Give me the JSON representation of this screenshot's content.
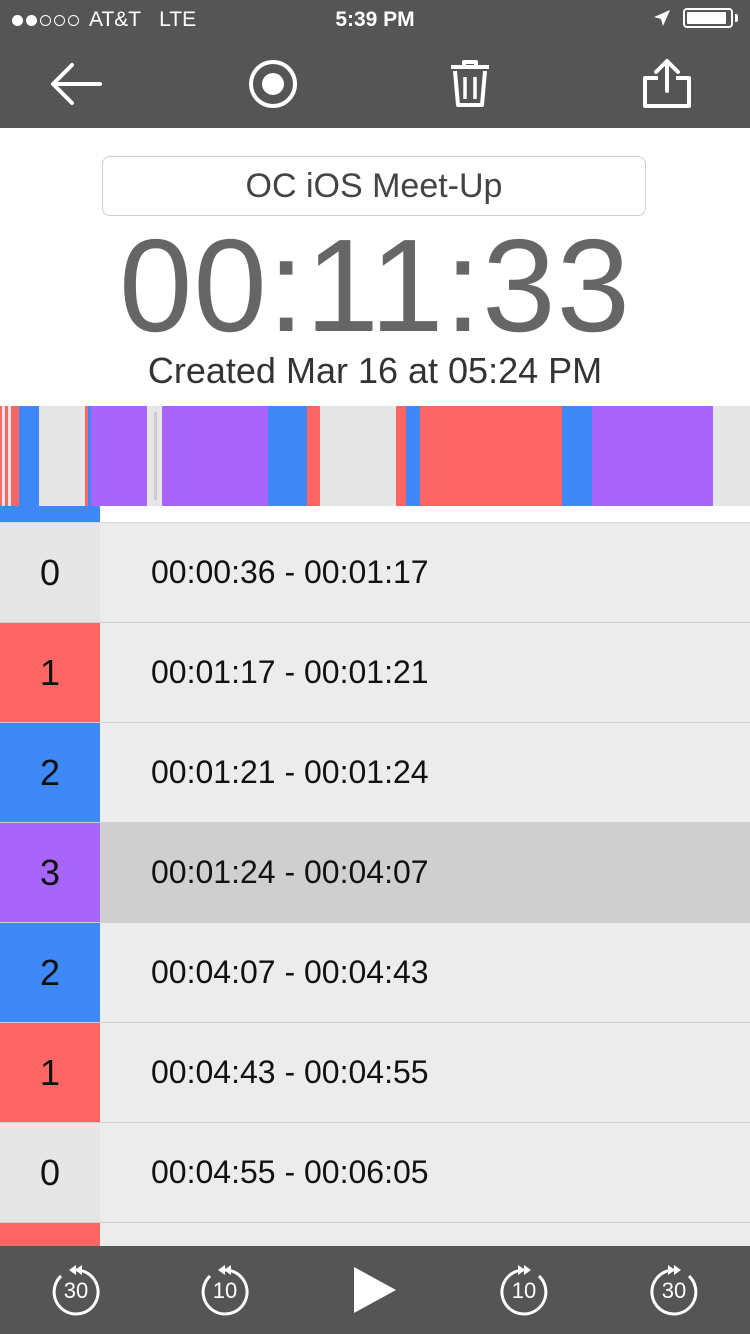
{
  "status": {
    "carrier": "AT&T",
    "network": "LTE",
    "time": "5:39 PM",
    "signal_dots": [
      true,
      true,
      false,
      false,
      false
    ],
    "battery_level": 0.92
  },
  "toolbar": {
    "icons": [
      "back-arrow-icon",
      "record-icon",
      "trash-icon",
      "share-icon"
    ]
  },
  "recording": {
    "title": "OC iOS Meet-Up",
    "elapsed": "00:11:33",
    "created": "Created Mar 16 at 05:24 PM"
  },
  "colors": {
    "level_0": "#e6e6e6",
    "level_1": "#fe6665",
    "level_2": "#3f88f7",
    "level_3": "#a765fb",
    "bar": "#555555"
  },
  "timeline": {
    "segments": [
      {
        "level": 1,
        "start": 0,
        "end": 0.003
      },
      {
        "level": 0,
        "start": 0.003,
        "end": 0.007
      },
      {
        "level": 1,
        "start": 0.007,
        "end": 0.011
      },
      {
        "level": 0,
        "start": 0.011,
        "end": 0.015
      },
      {
        "level": 1,
        "start": 0.015,
        "end": 0.025
      },
      {
        "level": 2,
        "start": 0.025,
        "end": 0.052
      },
      {
        "level": 0,
        "start": 0.052,
        "end": 0.113
      },
      {
        "level": 1,
        "start": 0.113,
        "end": 0.117
      },
      {
        "level": 2,
        "start": 0.117,
        "end": 0.121
      },
      {
        "level": 3,
        "start": 0.121,
        "end": 0.196
      },
      {
        "level": 0,
        "start": 0.196,
        "end": 0.216
      },
      {
        "level": 3,
        "start": 0.216,
        "end": 0.357
      },
      {
        "level": 2,
        "start": 0.357,
        "end": 0.409
      },
      {
        "level": 1,
        "start": 0.409,
        "end": 0.427
      },
      {
        "level": 0,
        "start": 0.427,
        "end": 0.528
      },
      {
        "level": 1,
        "start": 0.528,
        "end": 0.541
      },
      {
        "level": 2,
        "start": 0.541,
        "end": 0.56
      },
      {
        "level": 1,
        "start": 0.56,
        "end": 0.749
      },
      {
        "level": 2,
        "start": 0.749,
        "end": 0.789
      },
      {
        "level": 3,
        "start": 0.789,
        "end": 0.951
      },
      {
        "level": 0,
        "start": 0.951,
        "end": 1.0
      }
    ],
    "playhead_fraction": 0.205
  },
  "segment_rows": [
    {
      "level": "0",
      "range": "00:00:36 - 00:01:17",
      "level_key": 0,
      "selected": false
    },
    {
      "level": "1",
      "range": "00:01:17 - 00:01:21",
      "level_key": 1,
      "selected": false
    },
    {
      "level": "2",
      "range": "00:01:21 - 00:01:24",
      "level_key": 2,
      "selected": false
    },
    {
      "level": "3",
      "range": "00:01:24 - 00:04:07",
      "level_key": 3,
      "selected": true
    },
    {
      "level": "2",
      "range": "00:04:07 - 00:04:43",
      "level_key": 2,
      "selected": false
    },
    {
      "level": "1",
      "range": "00:04:43 - 00:04:55",
      "level_key": 1,
      "selected": false
    },
    {
      "level": "0",
      "range": "00:04:55 - 00:06:05",
      "level_key": 0,
      "selected": false
    },
    {
      "level": "",
      "range": "",
      "level_key": 1,
      "selected": false
    }
  ],
  "player": {
    "rewind_30": "30",
    "rewind_10": "10",
    "forward_10": "10",
    "forward_30": "30",
    "icons": [
      "rewind-30-icon",
      "rewind-10-icon",
      "play-icon",
      "forward-10-icon",
      "forward-30-icon"
    ]
  }
}
